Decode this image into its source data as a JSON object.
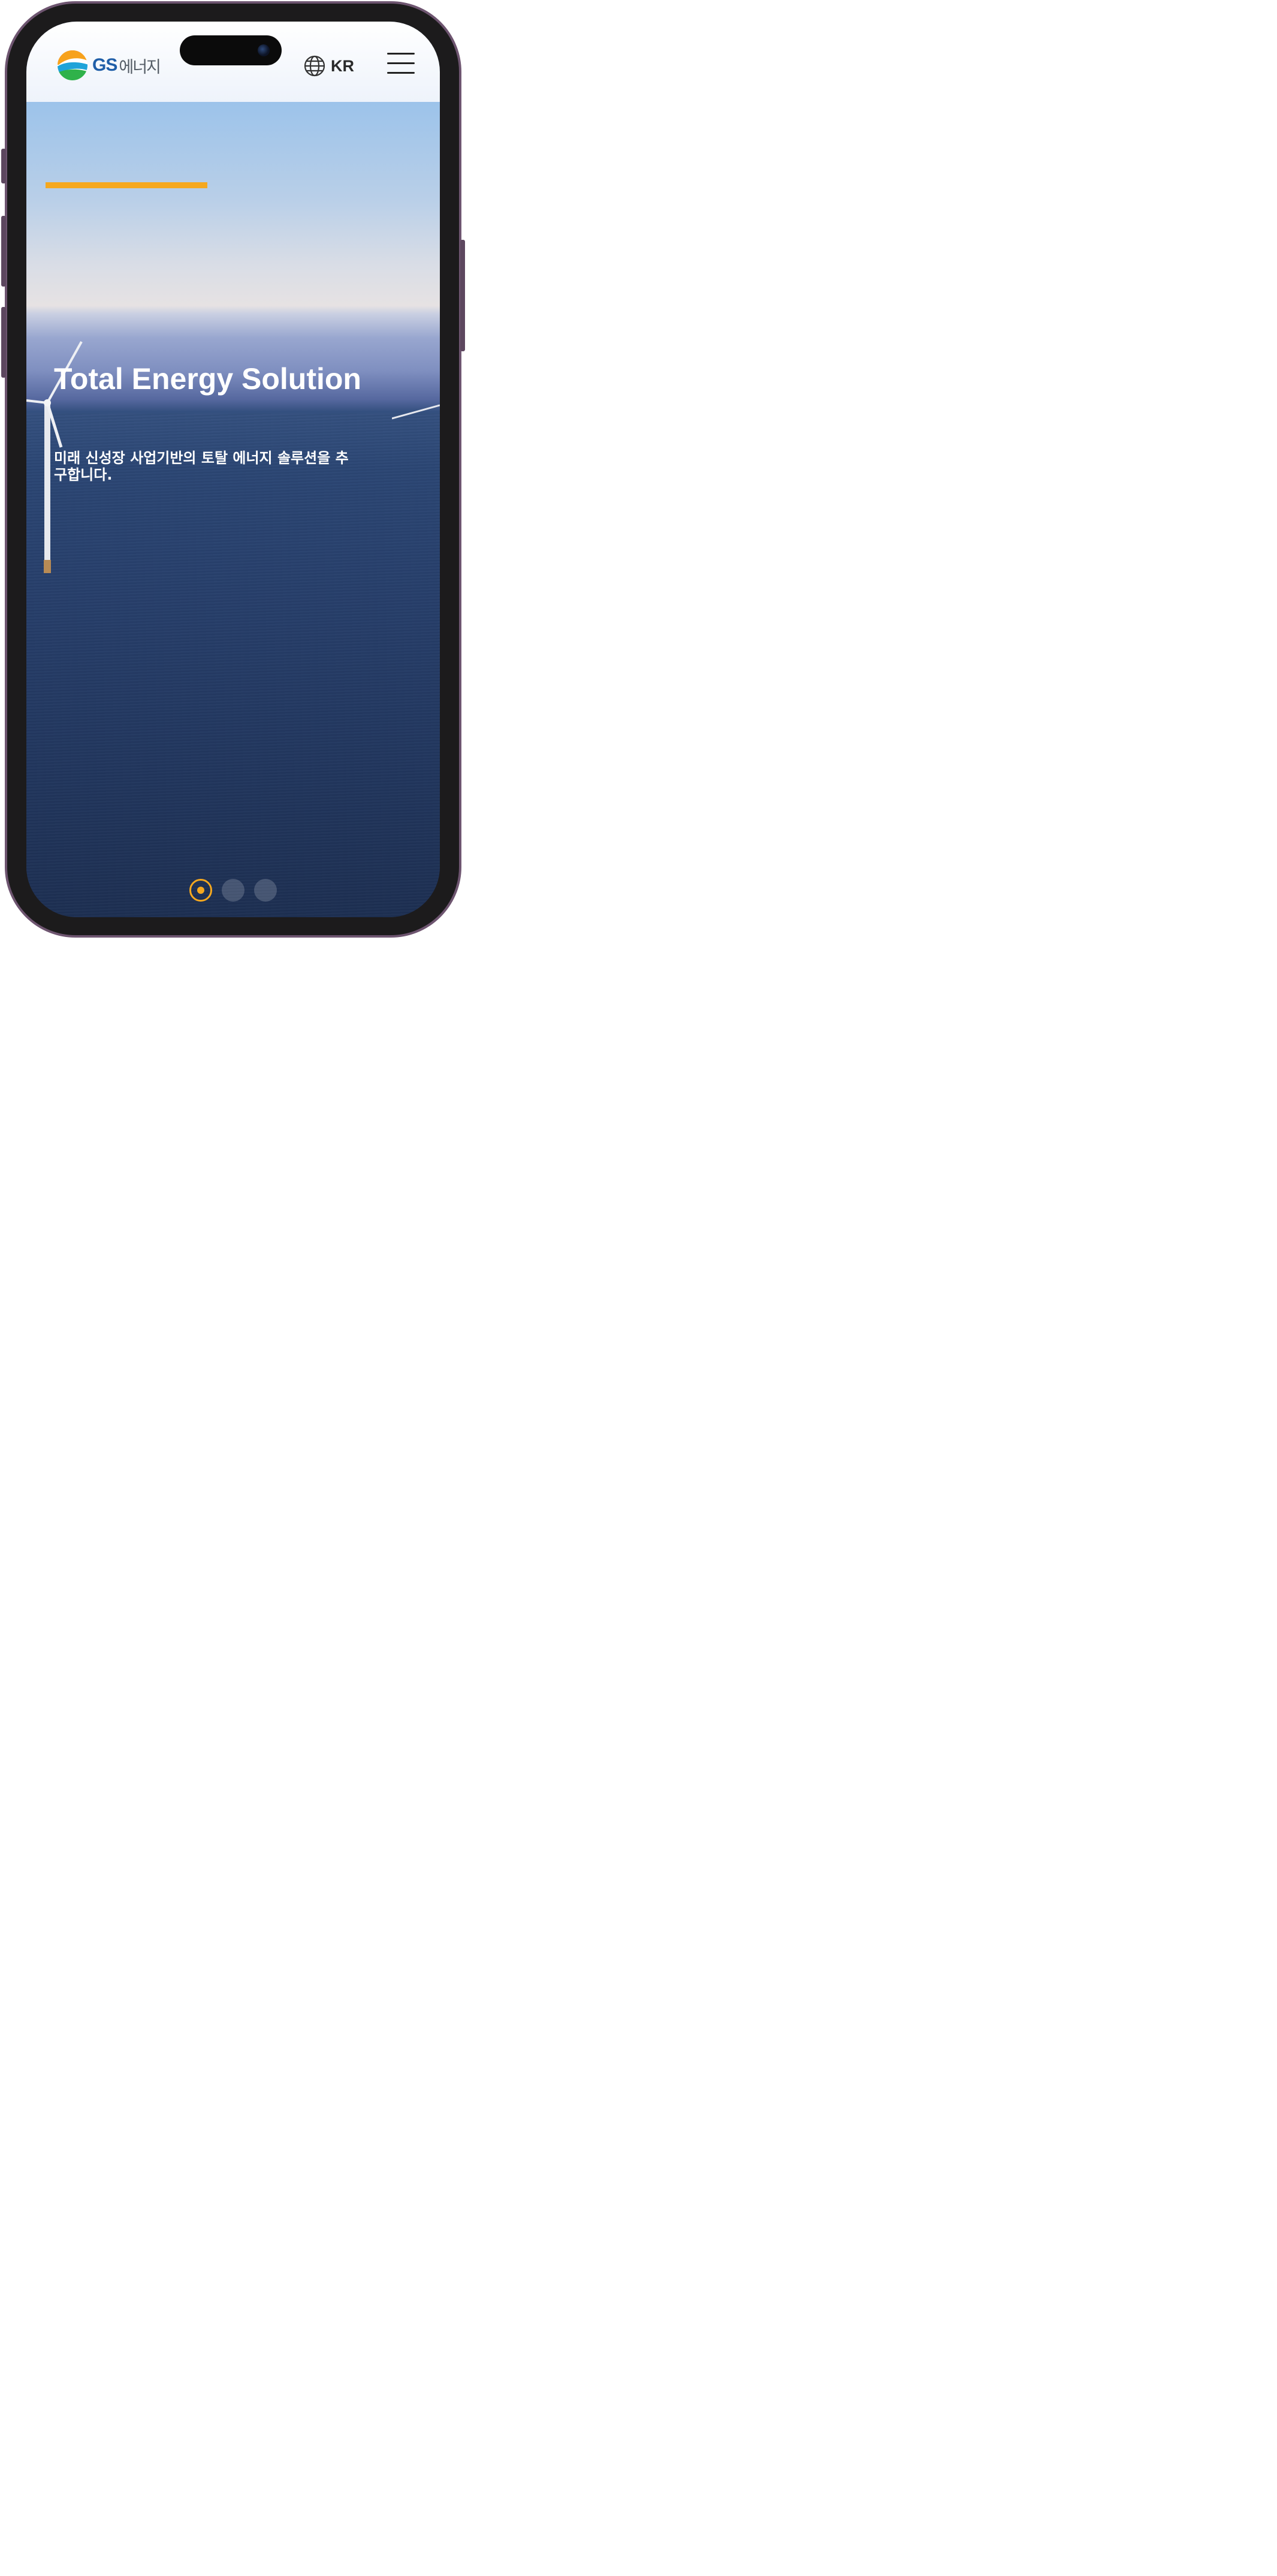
{
  "header": {
    "logo_brand": "GS",
    "logo_suffix": "에너지",
    "language_label": "KR"
  },
  "hero": {
    "title": "Total Energy Solution",
    "subtitle": "미래 신성장 사업기반의 토탈 에너지 솔루션을 추구합니다.",
    "slides_total": 3,
    "active_slide": 1
  },
  "icons": {
    "logo": "gs-logo-icon",
    "language": "globe-icon",
    "menu": "hamburger-menu-icon"
  },
  "colors": {
    "accent": "#f5a81f",
    "brand_blue": "#1f5ea8",
    "phone_frame": "#6e5570"
  }
}
